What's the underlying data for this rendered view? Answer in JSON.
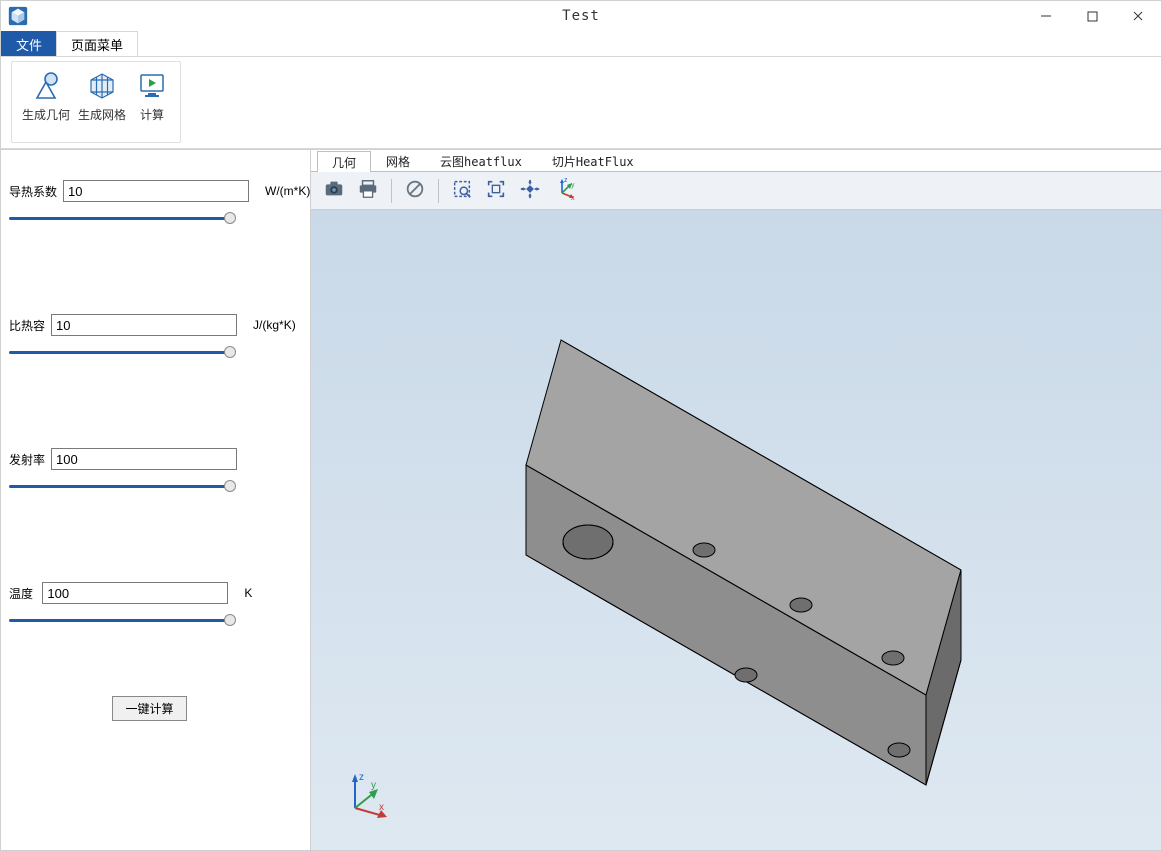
{
  "window": {
    "title": "Test"
  },
  "menu": {
    "tabs": [
      {
        "label": "文件",
        "active": true
      },
      {
        "label": "页面菜单",
        "active": false
      }
    ]
  },
  "ribbon": {
    "buttons": [
      {
        "label": "生成几何"
      },
      {
        "label": "生成网格"
      },
      {
        "label": "计算"
      }
    ]
  },
  "params": {
    "conductivity": {
      "label": "导热系数",
      "value": "10",
      "unit": "W/(m*K)"
    },
    "heat_capacity": {
      "label": "比热容",
      "value": "10",
      "unit": "J/(kg*K)"
    },
    "emissivity": {
      "label": "发射率",
      "value": "100",
      "unit": ""
    },
    "temperature": {
      "label": "温度",
      "value": "100",
      "unit": "K"
    }
  },
  "sidebar": {
    "calc_button": "一键计算"
  },
  "viewport": {
    "tabs": [
      {
        "label": "几何",
        "active": true
      },
      {
        "label": "网格",
        "active": false
      },
      {
        "label": "云图heatflux",
        "active": false
      },
      {
        "label": "切片HeatFlux",
        "active": false
      }
    ],
    "axis": {
      "x": "x",
      "y": "y",
      "z": "z"
    }
  }
}
